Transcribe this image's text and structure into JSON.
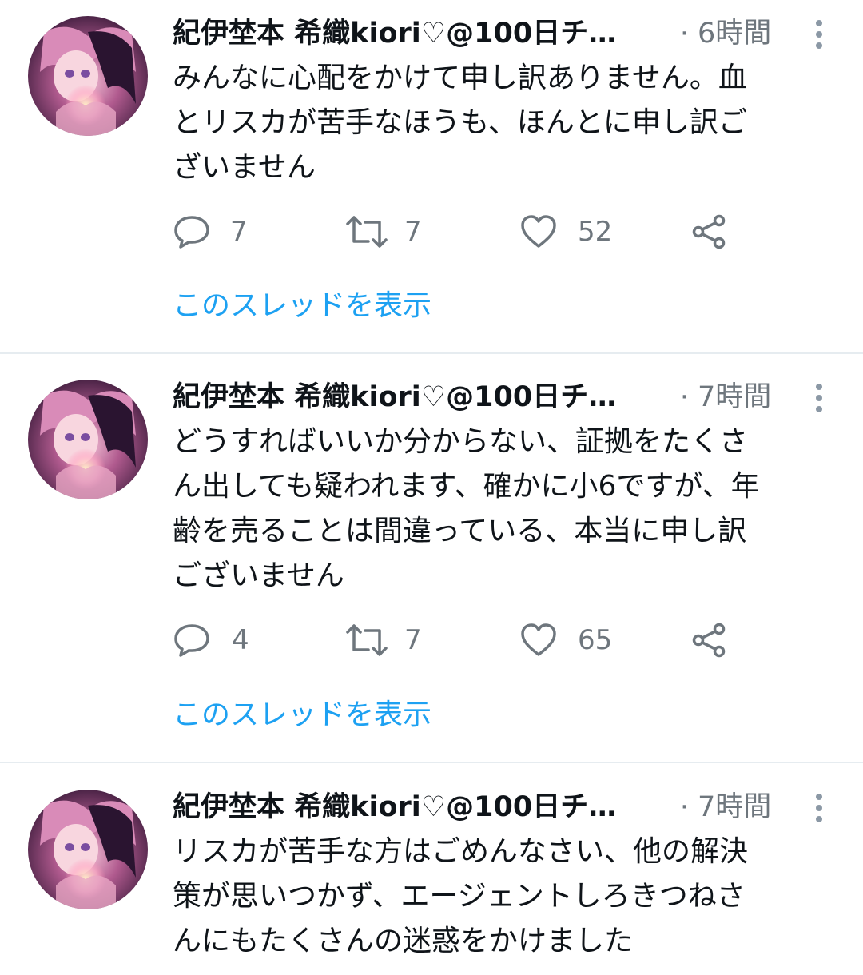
{
  "tweets": [
    {
      "author_name": "紀伊埜本 希織kiori♡@100日チ…",
      "separator": "·",
      "time": "6時間",
      "text": "みんなに心配をかけて申し訳ありません。血\nとリスカが苦手なほうも、ほんとに申し訳ご\nざいません",
      "reply_count": "7",
      "retweet_count": "7",
      "like_count": "52",
      "thread_link": "このスレッドを表示"
    },
    {
      "author_name": "紀伊埜本 希織kiori♡@100日チ…",
      "separator": "·",
      "time": "7時間",
      "text": "どうすればいいか分からない、証拠をたくさ\nん出しても疑われます、確かに小6ですが、年\n齢を売ることは間違っている、本当に申し訳\nございません",
      "reply_count": "4",
      "retweet_count": "7",
      "like_count": "65",
      "thread_link": "このスレッドを表示"
    },
    {
      "author_name": "紀伊埜本 希織kiori♡@100日チ…",
      "separator": "·",
      "time": "7時間",
      "text": "リスカが苦手な方はごめんなさい、他の解決\n策が思いつかず、エージェントしろきつねさ\nんにもたくさんの迷惑をかけました"
    }
  ],
  "icons": {
    "reply": "reply-icon",
    "retweet": "retweet-icon",
    "like": "heart-icon",
    "share": "share-icon",
    "more": "more-vertical-icon"
  },
  "colors": {
    "text": "#0f1419",
    "secondary": "#6e767d",
    "link": "#1da1f2",
    "divider": "#e6ecf0"
  }
}
